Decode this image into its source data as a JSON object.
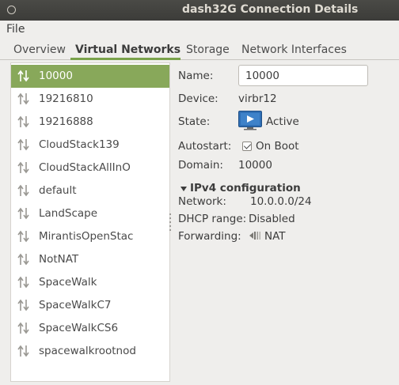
{
  "window": {
    "title": "dash32G Connection Details"
  },
  "menubar": {
    "file": "File"
  },
  "tabs": [
    {
      "label": "Overview"
    },
    {
      "label": "Virtual Networks"
    },
    {
      "label": "Storage"
    },
    {
      "label": "Network Interfaces"
    }
  ],
  "networks": [
    {
      "label": "10000"
    },
    {
      "label": "19216810"
    },
    {
      "label": "19216888"
    },
    {
      "label": "CloudStack139"
    },
    {
      "label": "CloudStackAllInO"
    },
    {
      "label": "default"
    },
    {
      "label": "LandScape"
    },
    {
      "label": "MirantisOpenStac"
    },
    {
      "label": "NotNAT"
    },
    {
      "label": "SpaceWalk"
    },
    {
      "label": "SpaceWalkC7"
    },
    {
      "label": "SpaceWalkCS6"
    },
    {
      "label": "spacewalkrootnod"
    }
  ],
  "details": {
    "name_label": "Name:",
    "name_value": "10000",
    "device_label": "Device:",
    "device_value": "virbr12",
    "state_label": "State:",
    "state_value": "Active",
    "autostart_label": "Autostart:",
    "autostart_value": "On Boot",
    "domain_label": "Domain:",
    "domain_value": "10000",
    "ipv4": {
      "title": "IPv4 configuration",
      "network_label": "Network:",
      "network_value": "10.0.0.0/24",
      "dhcp_label": "DHCP range:",
      "dhcp_value": "Disabled",
      "forwarding_label": "Forwarding:",
      "forwarding_value": "NAT"
    }
  },
  "colors": {
    "titlebar": "#3c3c39",
    "selection": "#88a85a",
    "tab_underline": "#7aa24b",
    "state_icon": "#2f6fb5"
  }
}
